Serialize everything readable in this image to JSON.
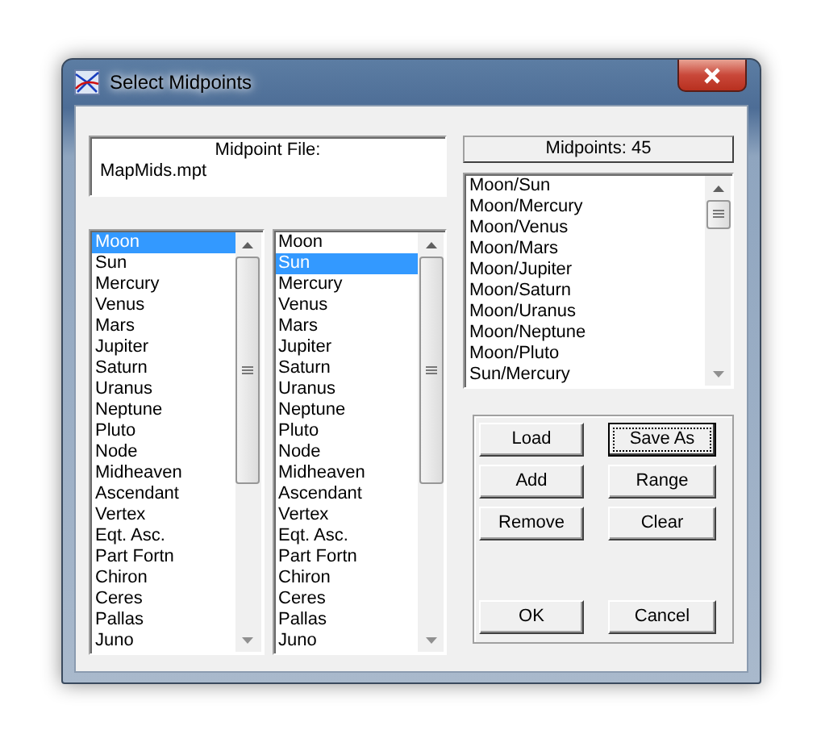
{
  "window": {
    "title": "Select Midpoints"
  },
  "midpoint_file": {
    "title": "Midpoint File:",
    "value": "MapMids.mpt"
  },
  "list_a": {
    "items": [
      {
        "label": "Moon",
        "selected": true
      },
      {
        "label": "Sun",
        "selected": false
      },
      {
        "label": "Mercury",
        "selected": false
      },
      {
        "label": "Venus",
        "selected": false
      },
      {
        "label": "Mars",
        "selected": false
      },
      {
        "label": "Jupiter",
        "selected": false
      },
      {
        "label": "Saturn",
        "selected": false
      },
      {
        "label": "Uranus",
        "selected": false
      },
      {
        "label": "Neptune",
        "selected": false
      },
      {
        "label": "Pluto",
        "selected": false
      },
      {
        "label": "Node",
        "selected": false
      },
      {
        "label": "Midheaven",
        "selected": false
      },
      {
        "label": "Ascendant",
        "selected": false
      },
      {
        "label": "Vertex",
        "selected": false
      },
      {
        "label": "Eqt. Asc.",
        "selected": false
      },
      {
        "label": "Part Fortn",
        "selected": false
      },
      {
        "label": "Chiron",
        "selected": false
      },
      {
        "label": "Ceres",
        "selected": false
      },
      {
        "label": "Pallas",
        "selected": false
      },
      {
        "label": "Juno",
        "selected": false
      }
    ]
  },
  "list_b": {
    "items": [
      {
        "label": "Moon",
        "selected": false
      },
      {
        "label": "Sun",
        "selected": true
      },
      {
        "label": "Mercury",
        "selected": false
      },
      {
        "label": "Venus",
        "selected": false
      },
      {
        "label": "Mars",
        "selected": false
      },
      {
        "label": "Jupiter",
        "selected": false
      },
      {
        "label": "Saturn",
        "selected": false
      },
      {
        "label": "Uranus",
        "selected": false
      },
      {
        "label": "Neptune",
        "selected": false
      },
      {
        "label": "Pluto",
        "selected": false
      },
      {
        "label": "Node",
        "selected": false
      },
      {
        "label": "Midheaven",
        "selected": false
      },
      {
        "label": "Ascendant",
        "selected": false
      },
      {
        "label": "Vertex",
        "selected": false
      },
      {
        "label": "Eqt. Asc.",
        "selected": false
      },
      {
        "label": "Part Fortn",
        "selected": false
      },
      {
        "label": "Chiron",
        "selected": false
      },
      {
        "label": "Ceres",
        "selected": false
      },
      {
        "label": "Pallas",
        "selected": false
      },
      {
        "label": "Juno",
        "selected": false
      }
    ]
  },
  "midpoints": {
    "label": "Midpoints: 45",
    "items": [
      "Moon/Sun",
      "Moon/Mercury",
      "Moon/Venus",
      "Moon/Mars",
      "Moon/Jupiter",
      "Moon/Saturn",
      "Moon/Uranus",
      "Moon/Neptune",
      "Moon/Pluto",
      "Sun/Mercury"
    ]
  },
  "buttons": [
    {
      "label": "Load",
      "focused": false
    },
    {
      "label": "Save As",
      "focused": true
    },
    {
      "label": "Add",
      "focused": false
    },
    {
      "label": "Range",
      "focused": false
    },
    {
      "label": "Remove",
      "focused": false
    },
    {
      "label": "Clear",
      "focused": false
    }
  ],
  "dialog_buttons": [
    {
      "label": "OK",
      "focused": false
    },
    {
      "label": "Cancel",
      "focused": false
    }
  ]
}
